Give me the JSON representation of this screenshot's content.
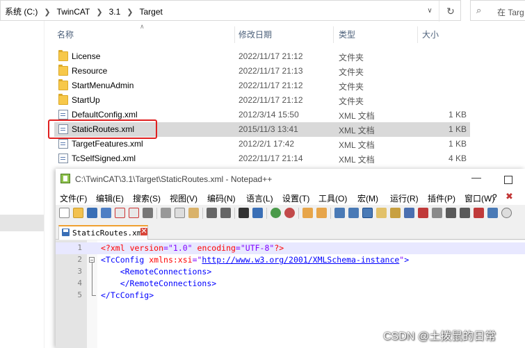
{
  "explorer": {
    "breadcrumb": [
      "系统 (C:)",
      "TwinCAT",
      "3.1",
      "Target"
    ],
    "search_placeholder": "在 Targ",
    "columns": {
      "name": "名称",
      "date": "修改日期",
      "type": "类型",
      "size": "大小"
    },
    "files": [
      {
        "name": "License",
        "date": "2022/11/17 21:12",
        "type": "文件夹",
        "size": "",
        "icon": "folder-icon"
      },
      {
        "name": "Resource",
        "date": "2022/11/17 21:13",
        "type": "文件夹",
        "size": "",
        "icon": "folder-icon"
      },
      {
        "name": "StartMenuAdmin",
        "date": "2022/11/17 21:12",
        "type": "文件夹",
        "size": "",
        "icon": "folder-icon"
      },
      {
        "name": "StartUp",
        "date": "2022/11/17 21:12",
        "type": "文件夹",
        "size": "",
        "icon": "folder-icon"
      },
      {
        "name": "DefaultConfig.xml",
        "date": "2012/3/14 15:50",
        "type": "XML 文档",
        "size": "1 KB",
        "icon": "xml-file-icon"
      },
      {
        "name": "StaticRoutes.xml",
        "date": "2015/11/3 13:41",
        "type": "XML 文档",
        "size": "1 KB",
        "icon": "xml-file-icon",
        "selected": true
      },
      {
        "name": "TargetFeatures.xml",
        "date": "2012/2/1 17:42",
        "type": "XML 文档",
        "size": "1 KB",
        "icon": "xml-file-icon"
      },
      {
        "name": "TcSelfSigned.xml",
        "date": "2022/11/17 21:14",
        "type": "XML 文档",
        "size": "4 KB",
        "icon": "xml-file-icon"
      }
    ],
    "highlight_color": "#e02020"
  },
  "notepad": {
    "title": "C:\\TwinCAT\\3.1\\Target\\StaticRoutes.xml - Notepad++",
    "menu": [
      "文件(F)",
      "编辑(E)",
      "搜索(S)",
      "视图(V)",
      "编码(N)",
      "语言(L)",
      "设置(T)",
      "工具(O)",
      "宏(M)",
      "运行(R)",
      "插件(P)",
      "窗口(W)",
      "?"
    ],
    "tab_label": "StaticRoutes.xml",
    "lines": [
      {
        "no": "1",
        "text": "<?xml version=\"1.0\" encoding=\"UTF-8\"?>"
      },
      {
        "no": "2",
        "text": "<TcConfig xmlns:xsi=\"http://www.w3.org/2001/XMLSchema-instance\">"
      },
      {
        "no": "3",
        "text": "<RemoteConnections>"
      },
      {
        "no": "4",
        "text": "</RemoteConnections>"
      },
      {
        "no": "5",
        "text": "</TcConfig>"
      }
    ],
    "xml": {
      "decl_open": "<?xml",
      "version_attr": "version",
      "version_val": "\"1.0\"",
      "encoding_attr": "encoding",
      "encoding_val": "\"UTF-8\"",
      "decl_close": "?>",
      "root_open": "<TcConfig",
      "xmlns_attr": "xmlns:xsi",
      "xmlns_url": "http://www.w3.org/2001/XMLSchema-instance",
      "remote_open": "<RemoteConnections>",
      "remote_close": "</RemoteConnections>",
      "root_close": "</TcConfig>"
    }
  },
  "watermark": "CSDN @土拨鼠的日常"
}
